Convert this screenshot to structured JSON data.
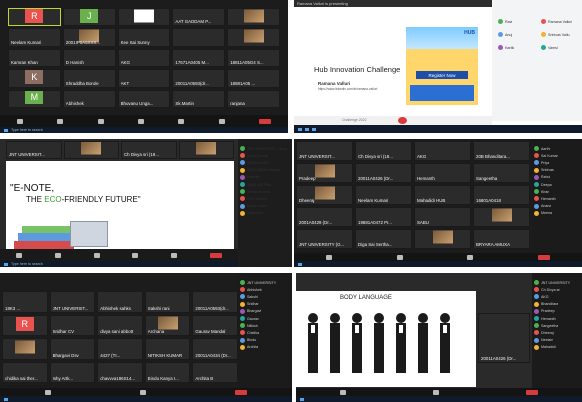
{
  "panel1": {
    "tiles": [
      {
        "name": "",
        "initial": "R",
        "color": "#e8534f",
        "active": true
      },
      {
        "name": "",
        "initial": "J",
        "color": "#6ab04c"
      },
      {
        "name": "",
        "initial": "",
        "color": "#ffffff",
        "logo": true
      },
      {
        "name": "AAT GADDAM P...",
        "initial": ""
      },
      {
        "name": "",
        "initial": "",
        "img": true
      },
      {
        "name": "Neelam Kumari",
        "initial": ""
      },
      {
        "name": "2001IP0A5XXX...",
        "img": true
      },
      {
        "name": "Kee Sai Sunny",
        "initial": ""
      },
      {
        "name": "",
        "initial": ""
      },
      {
        "name": "",
        "initial": "",
        "img": true
      },
      {
        "name": "Kamran Khan",
        "initial": ""
      },
      {
        "name": "D Hanish",
        "initial": ""
      },
      {
        "name": "AKG",
        "initial": ""
      },
      {
        "name": "17671A0405 M...",
        "initial": ""
      },
      {
        "name": "18811A05G4 S...",
        "initial": ""
      },
      {
        "name": "",
        "initial": "K",
        "color": "#8d6e63"
      },
      {
        "name": "Shraddha Borole",
        "initial": ""
      },
      {
        "name": "AKT",
        "initial": ""
      },
      {
        "name": "20011A0593(dr...",
        "initial": ""
      },
      {
        "name": "18881A05 ...",
        "initial": ""
      },
      {
        "name": "",
        "initial": "M",
        "color": "#6ab04c"
      },
      {
        "name": "Abhishek",
        "initial": ""
      },
      {
        "name": "Bhuvanu Unga...",
        "initial": ""
      },
      {
        "name": "Sk.Martin",
        "initial": ""
      },
      {
        "name": "ranjana",
        "initial": ""
      }
    ]
  },
  "panel2": {
    "top_bar": "Ramana Valluri is presenting",
    "slide_title": "Hub Innovation Challenge",
    "presenter": "Ramana Valluri",
    "presenter_link": "https://www.linkedin.com/in/ramana-valluri",
    "brand": "HUB",
    "cta": "Register Now",
    "footer_text": "Challenge 2022",
    "participants": [
      "Ravi",
      "Ramana Valluri",
      "Anuj",
      "Srinivas Vallu",
      "Kartik",
      "Vamsi"
    ]
  },
  "panel3": {
    "slide_line1": "E-NOTE,",
    "slide_line2_prefix": "THE ",
    "slide_line2_eco": "ECO",
    "slide_line2_rest": "-FRIENDLY FUTURE",
    "quote": "\"",
    "tiles": [
      {
        "name": "JNT UNIVERSIT..."
      },
      {
        "name": "",
        "img": true
      },
      {
        "name": "Ch Divya sri (19..."
      },
      {
        "name": "",
        "img": true
      }
    ],
    "participants": [
      "JNT UNIVERSITY - Anup",
      "Manoj Kumar",
      "200011A0432",
      "20011A0593 dhyana",
      "Harshith",
      "18811A05 Pilla",
      "Sravan Kumar",
      "17671A0405",
      "Kalyan Ram",
      "18881A05"
    ]
  },
  "panel4": {
    "tiles": [
      {
        "name": "JNT UNIVERSIT..."
      },
      {
        "name": "Ch Divya sri (18..."
      },
      {
        "name": "AKG"
      },
      {
        "name": "20B Bhanditara..."
      },
      {
        "name": "Pradeep",
        "img": true
      },
      {
        "name": "20011A0426 (Dr..."
      },
      {
        "name": "Hemanth"
      },
      {
        "name": "Sangeetha"
      },
      {
        "name": "Dheeraj",
        "img": true
      },
      {
        "name": "Neelam Kumari"
      },
      {
        "name": "Mahadidi HUB"
      },
      {
        "name": "16801A0418"
      },
      {
        "name": "2001A0429 (Dr..."
      },
      {
        "name": "19881A0472 Pr..."
      },
      {
        "name": "SABU"
      },
      {
        "name": "",
        "img": true
      },
      {
        "name": "JNT UNIVERSITY (G..."
      },
      {
        "name": "Diga Sai Sertha..."
      },
      {
        "name": "",
        "img": true
      },
      {
        "name": "BRYARA AMUXA"
      },
      {
        "name": "supriya"
      }
    ],
    "participants": [
      "Aarthi",
      "Sai Kumar",
      "Priya",
      "Srinivas",
      "Rahul",
      "Deepa",
      "Kiran",
      "Hemanth",
      "Anand",
      "Meena"
    ]
  },
  "panel5": {
    "tiles": [
      {
        "name": "18K3 ..."
      },
      {
        "name": "JNT UNIVERSIT..."
      },
      {
        "name": "Abhishek sahks"
      },
      {
        "name": "Sakshi rani"
      },
      {
        "name": "20011A0593(dr..."
      },
      {
        "name": "",
        "initial": "R",
        "color": "#e8534f"
      },
      {
        "name": "Sridhar CV"
      },
      {
        "name": "divya sani abbott"
      },
      {
        "name": "Archana",
        "img": true
      },
      {
        "name": "Gaurav Mandal"
      },
      {
        "name": "",
        "img": true
      },
      {
        "name": "Bhargavi Dsv"
      },
      {
        "name": "4427 (TI..."
      },
      {
        "name": "NITIKSH KUMAR"
      },
      {
        "name": "20011A0434 (Dr..."
      },
      {
        "name": "chidika sai ther..."
      },
      {
        "name": "Ishy Artk..."
      },
      {
        "name": "chavvva186S14..."
      },
      {
        "name": "Bindu Kanya I..."
      },
      {
        "name": "Archita B"
      },
      {
        "name": "Mahati"
      }
    ],
    "participants": [
      "JNT UNIVERSITY",
      "Abhishek",
      "Sakshi",
      "Sridhar",
      "Bhargavi",
      "Gaurav",
      "Nitiksh",
      "Chidika",
      "Bindu",
      "Archita"
    ]
  },
  "panel6": {
    "slide_title": "BODY LANGUAGE",
    "tile_name": "20011A0426 (Dr...",
    "participants": [
      "JNT UNIVERSITY",
      "Ch Divya sri",
      "AKG",
      "Bhanditara",
      "Pradeep",
      "Hemanth",
      "Sangeetha",
      "Dheeraj",
      "Neelam",
      "Mahadidi"
    ]
  }
}
